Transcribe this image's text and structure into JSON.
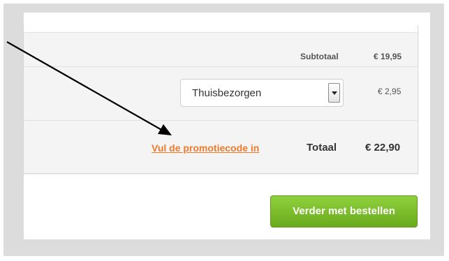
{
  "summary": {
    "subtotal_label": "Subtotaal",
    "subtotal_value": "€ 19,95",
    "delivery_select_value": "Thuisbezorgen",
    "delivery_cost": "€ 2,95",
    "promo_link": "Vul de promotiecode in",
    "total_label": "Totaal",
    "total_value": "€ 22,90"
  },
  "actions": {
    "continue_button": "Verder met bestellen"
  },
  "colors": {
    "promo_link": "#f07a2a",
    "continue_button": "#7cbf2c",
    "annotation_arrow": "#000000"
  },
  "icons": {
    "select_dropdown": "chevron-down-icon",
    "annotation": "arrow-icon"
  }
}
